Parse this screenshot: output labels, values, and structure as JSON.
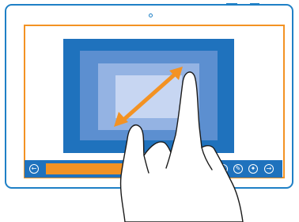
{
  "device": {
    "frame_color": "#1f80c6",
    "screen_border_color": "#f39223"
  },
  "screen": {
    "layers_colors": [
      "#1f72bd",
      "#5c8fd0",
      "#94b3e3",
      "#c7d6f2"
    ],
    "gesture": "pinch-zoom"
  },
  "taskbar": {
    "color": "#1f72bd",
    "progress_color": "#f39223",
    "icons": [
      {
        "name": "back-icon",
        "glyph": "←"
      },
      {
        "name": "settings-icon",
        "glyph": "⚙"
      },
      {
        "name": "pin-icon",
        "glyph": "✎"
      },
      {
        "name": "tools-icon",
        "glyph": "✦"
      },
      {
        "name": "forward-icon",
        "glyph": "→"
      }
    ]
  }
}
